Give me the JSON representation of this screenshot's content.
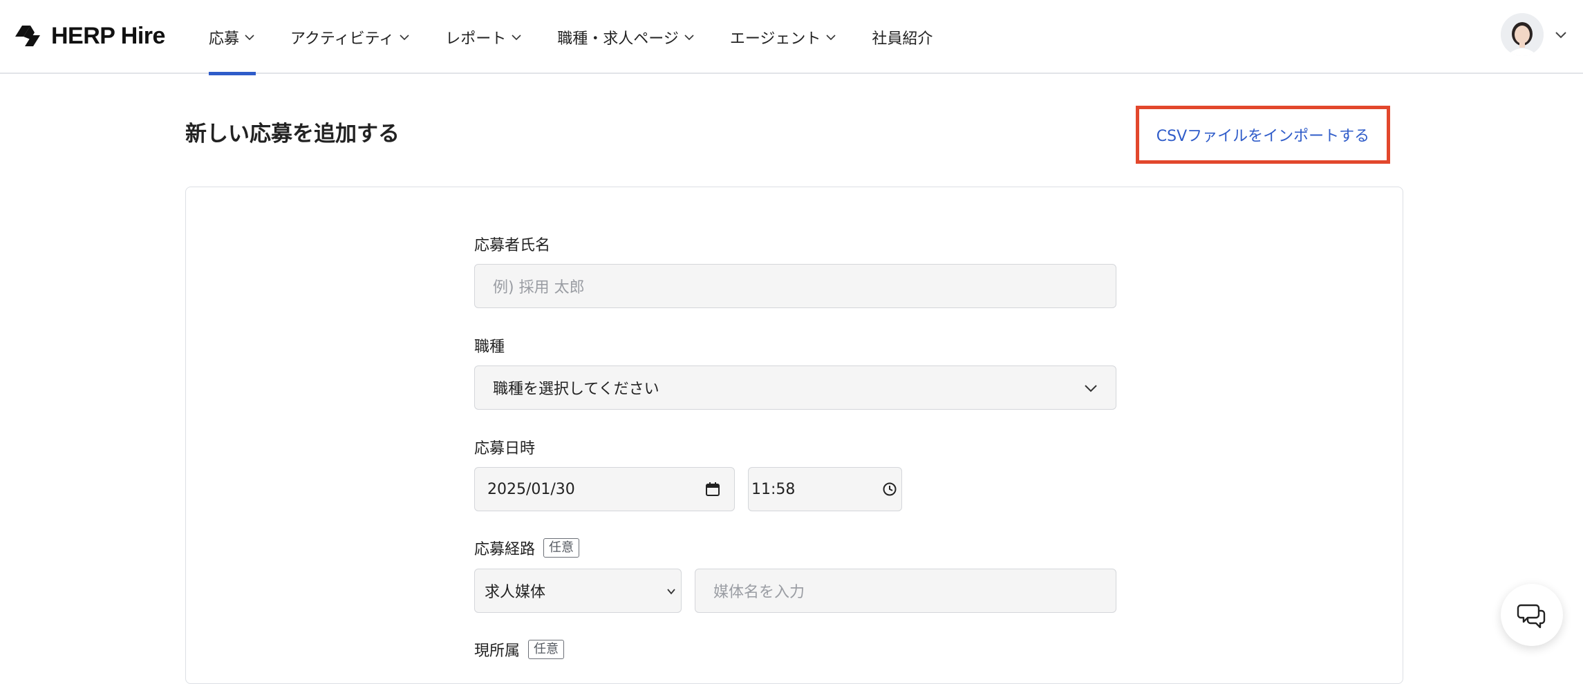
{
  "header": {
    "logo_text": "HERP Hire",
    "nav": [
      {
        "label": "応募",
        "has_dropdown": true,
        "active": true
      },
      {
        "label": "アクティビティ",
        "has_dropdown": true
      },
      {
        "label": "レポート",
        "has_dropdown": true
      },
      {
        "label": "職種・求人ページ",
        "has_dropdown": true
      },
      {
        "label": "エージェント",
        "has_dropdown": true
      },
      {
        "label": "社員紹介",
        "has_dropdown": false
      }
    ],
    "avatar_icon": "user-avatar",
    "account_menu_icon": "chevron-down-icon"
  },
  "page": {
    "title": "新しい応募を追加する",
    "csv_import_link": "CSVファイルをインポートする"
  },
  "form": {
    "applicant_name": {
      "label": "応募者氏名",
      "placeholder": "例) 採用 太郎"
    },
    "job": {
      "label": "職種",
      "value": "職種を選択してください"
    },
    "applied_at": {
      "label": "応募日時",
      "date": "2025/01/30",
      "time": "11:58"
    },
    "source": {
      "label": "応募経路",
      "badge": "任意",
      "value": "求人媒体",
      "media_placeholder": "媒体名を入力"
    },
    "current_company": {
      "label": "現所属",
      "badge": "任意"
    }
  },
  "chat": {
    "icon": "chat-icon"
  },
  "colors": {
    "accent": "#2f5cc9",
    "highlight": "#e2472c",
    "field_bg": "#f5f5f5"
  }
}
